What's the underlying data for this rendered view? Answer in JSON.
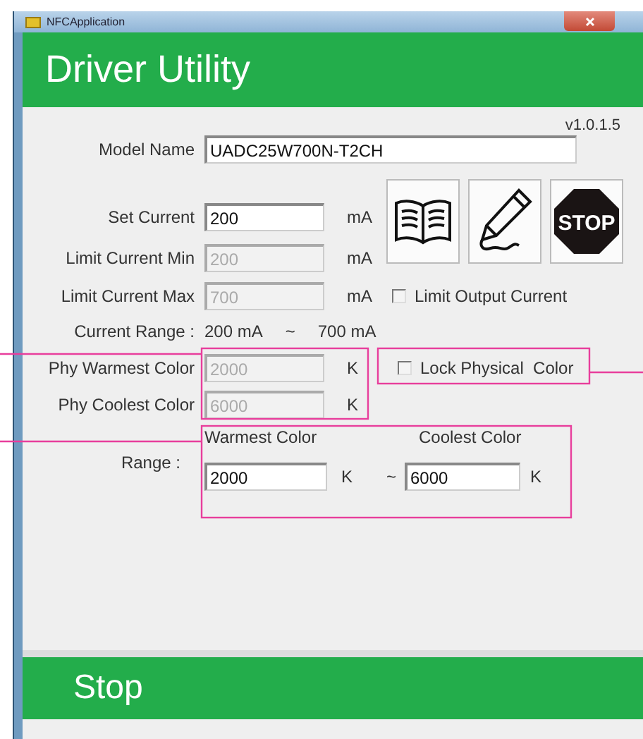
{
  "window": {
    "title": "NFCApplication"
  },
  "header": {
    "title": "Driver Utility"
  },
  "version": "v1.0.1.5",
  "model_name": {
    "label": "Model Name",
    "value": "UADC25W700N-T2CH"
  },
  "current_fields": [
    {
      "label": "Set Current",
      "value": "200",
      "unit": "mA",
      "disabled": false
    },
    {
      "label": "Limit Current Min",
      "value": "200",
      "unit": "mA",
      "disabled": true
    },
    {
      "label": "Limit Current Max",
      "value": "700",
      "unit": "mA",
      "disabled": true
    }
  ],
  "toolbar": [
    {
      "kind": "book"
    },
    {
      "kind": "pencil"
    },
    {
      "kind": "stop",
      "label": "STOP"
    }
  ],
  "limit_output_current": {
    "label": "Limit Output Current",
    "checked": false
  },
  "current_range": {
    "label": "Current Range :",
    "min": "200 mA",
    "separator": "~",
    "max": "700 mA"
  },
  "phy_colors": [
    {
      "label": "Phy Warmest Color",
      "value": "2000",
      "unit": "K",
      "disabled": true
    },
    {
      "label": "Phy Coolest Color",
      "value": "6000",
      "unit": "K",
      "disabled": true
    }
  ],
  "lock_physical_color": {
    "label": "Lock Physical  Color",
    "checked": false
  },
  "range": {
    "label": "Range :",
    "warmest": {
      "label": "Warmest Color",
      "value": "2000",
      "unit": "K"
    },
    "separator": "~",
    "coolest": {
      "label": "Coolest Color",
      "value": "6000",
      "unit": "K"
    }
  },
  "status_bar": {
    "text": "Stop"
  }
}
